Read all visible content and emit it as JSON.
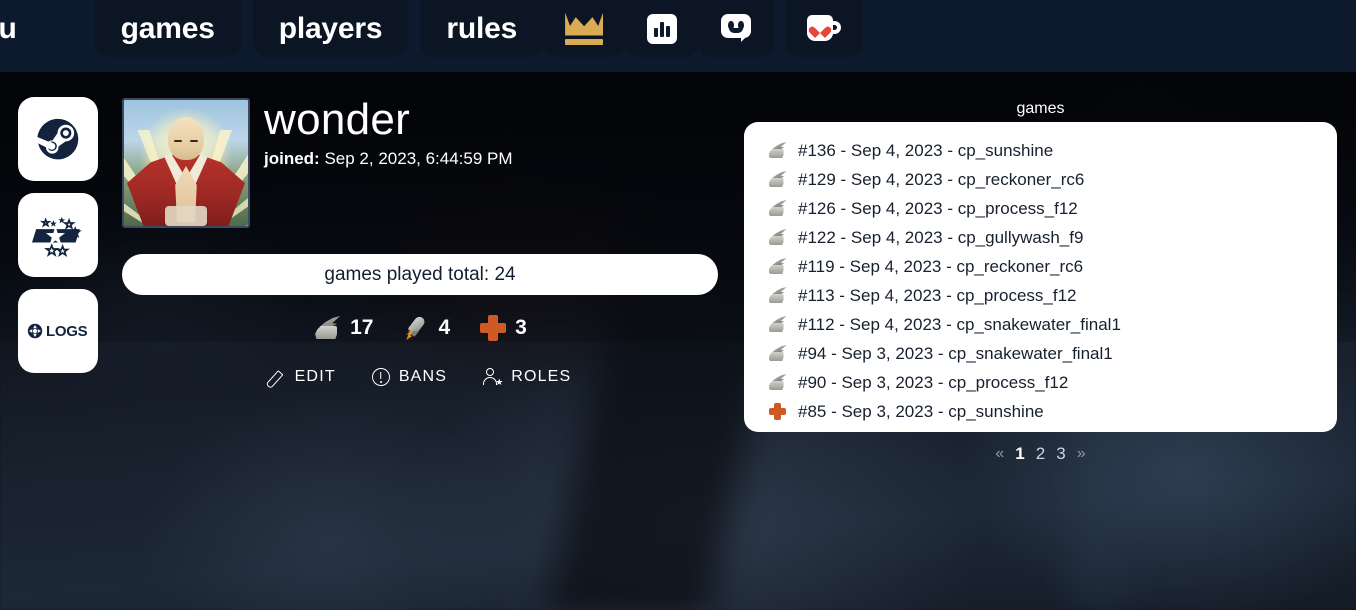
{
  "header": {
    "brand": "eu",
    "nav": [
      {
        "label": "games",
        "name": "nav-games"
      },
      {
        "label": "players",
        "name": "nav-players"
      },
      {
        "label": "rules",
        "name": "nav-rules"
      }
    ],
    "icons": [
      {
        "name": "crown-icon",
        "label": "crown"
      },
      {
        "name": "bar-chart-icon",
        "label": "stats"
      },
      {
        "name": "discord-icon",
        "label": "discord"
      },
      {
        "name": "coffee-heart-icon",
        "label": "donate"
      }
    ],
    "background": "#0d1a2e",
    "tab_background": "#0b1524"
  },
  "sidebar": {
    "items": [
      {
        "name": "steam-link",
        "label": "Steam"
      },
      {
        "name": "etf2l-link",
        "label": "ETF2L"
      },
      {
        "name": "logs-link",
        "label": "LOGS"
      }
    ]
  },
  "profile": {
    "username": "wonder",
    "joined_label": "joined:",
    "joined_value": "Sep 2, 2023, 6:44:59 PM",
    "total_games": "games played total: 24",
    "avatar_alt": "praying monk avatar",
    "class_stats": [
      {
        "class": "scout",
        "icon": "scout-icon",
        "count": "17"
      },
      {
        "class": "soldier",
        "icon": "rocket-icon",
        "count": "4"
      },
      {
        "class": "medic",
        "icon": "medic-icon",
        "count": "3"
      }
    ],
    "actions": [
      {
        "label": "EDIT",
        "icon": "pencil-icon"
      },
      {
        "label": "BANS",
        "icon": "warning-circle-icon"
      },
      {
        "label": "ROLES",
        "icon": "person-star-icon"
      }
    ]
  },
  "games_panel": {
    "title": "games",
    "rows": [
      {
        "icon": "scout-icon",
        "text": "#136 - Sep 4, 2023 - cp_sunshine"
      },
      {
        "icon": "scout-icon",
        "text": "#129 - Sep 4, 2023 - cp_reckoner_rc6"
      },
      {
        "icon": "scout-icon",
        "text": "#126 - Sep 4, 2023 - cp_process_f12"
      },
      {
        "icon": "scout-icon",
        "text": "#122 - Sep 4, 2023 - cp_gullywash_f9"
      },
      {
        "icon": "scout-icon",
        "text": "#119 - Sep 4, 2023 - cp_reckoner_rc6"
      },
      {
        "icon": "scout-icon",
        "text": "#113 - Sep 4, 2023 - cp_process_f12"
      },
      {
        "icon": "scout-icon",
        "text": "#112 - Sep 4, 2023 - cp_snakewater_final1"
      },
      {
        "icon": "scout-icon",
        "text": "#94 - Sep 3, 2023 - cp_snakewater_final1"
      },
      {
        "icon": "scout-icon",
        "text": "#90 - Sep 3, 2023 - cp_process_f12"
      },
      {
        "icon": "medic-icon",
        "text": "#85 - Sep 3, 2023 - cp_sunshine"
      }
    ]
  },
  "pagination": {
    "prev": "«",
    "next": "»",
    "pages": [
      "1",
      "2",
      "3"
    ],
    "active": "1"
  },
  "colors": {
    "header_navy": "#0d1a2e",
    "panel_white": "#ffffff",
    "panel_text": "#17202e",
    "crown_gold": "#d9ab53",
    "medic_orange": "#cf5a26",
    "heart_red": "#e8453c"
  }
}
